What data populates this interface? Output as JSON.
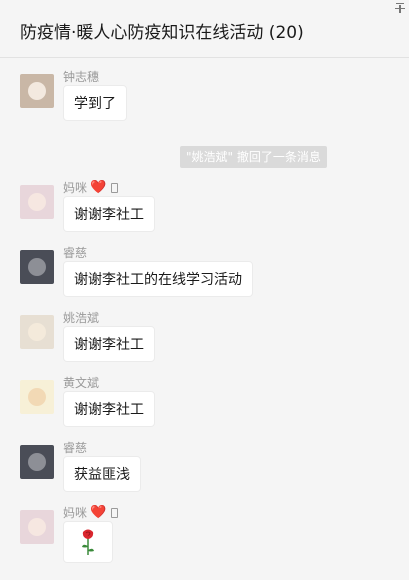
{
  "header": {
    "title": "防疫情·暖人心防疫知识在线活动 (20)"
  },
  "system_notice": "\"姚浩斌\" 撤回了一条消息",
  "messages": [
    {
      "sender": "钟志穗",
      "text": "学到了",
      "avatar": "cat-avatar"
    },
    {
      "sender": "妈咪",
      "text": "谢谢李社工",
      "avatar": "baby-avatar",
      "heart": "❤️"
    },
    {
      "sender": "睿慈",
      "text": "谢谢李社工的在线学习活动",
      "avatar": "dark-avatar"
    },
    {
      "sender": "姚浩斌",
      "text": "谢谢李社工",
      "avatar": "bowl-avatar"
    },
    {
      "sender": "黄文斌",
      "text": "谢谢李社工",
      "avatar": "cartoon-avatar"
    },
    {
      "sender": "睿慈",
      "text": "获益匪浅",
      "avatar": "dark-avatar"
    },
    {
      "sender": "妈咪",
      "text": "",
      "avatar": "baby-avatar",
      "heart": "❤️",
      "sticker": "rose-icon"
    }
  ],
  "colors": {
    "background": "#f5f5f5",
    "bubble": "#ffffff",
    "name": "#9a9a9a",
    "heart": "#d81e2a",
    "notice_bg": "#dadada"
  }
}
